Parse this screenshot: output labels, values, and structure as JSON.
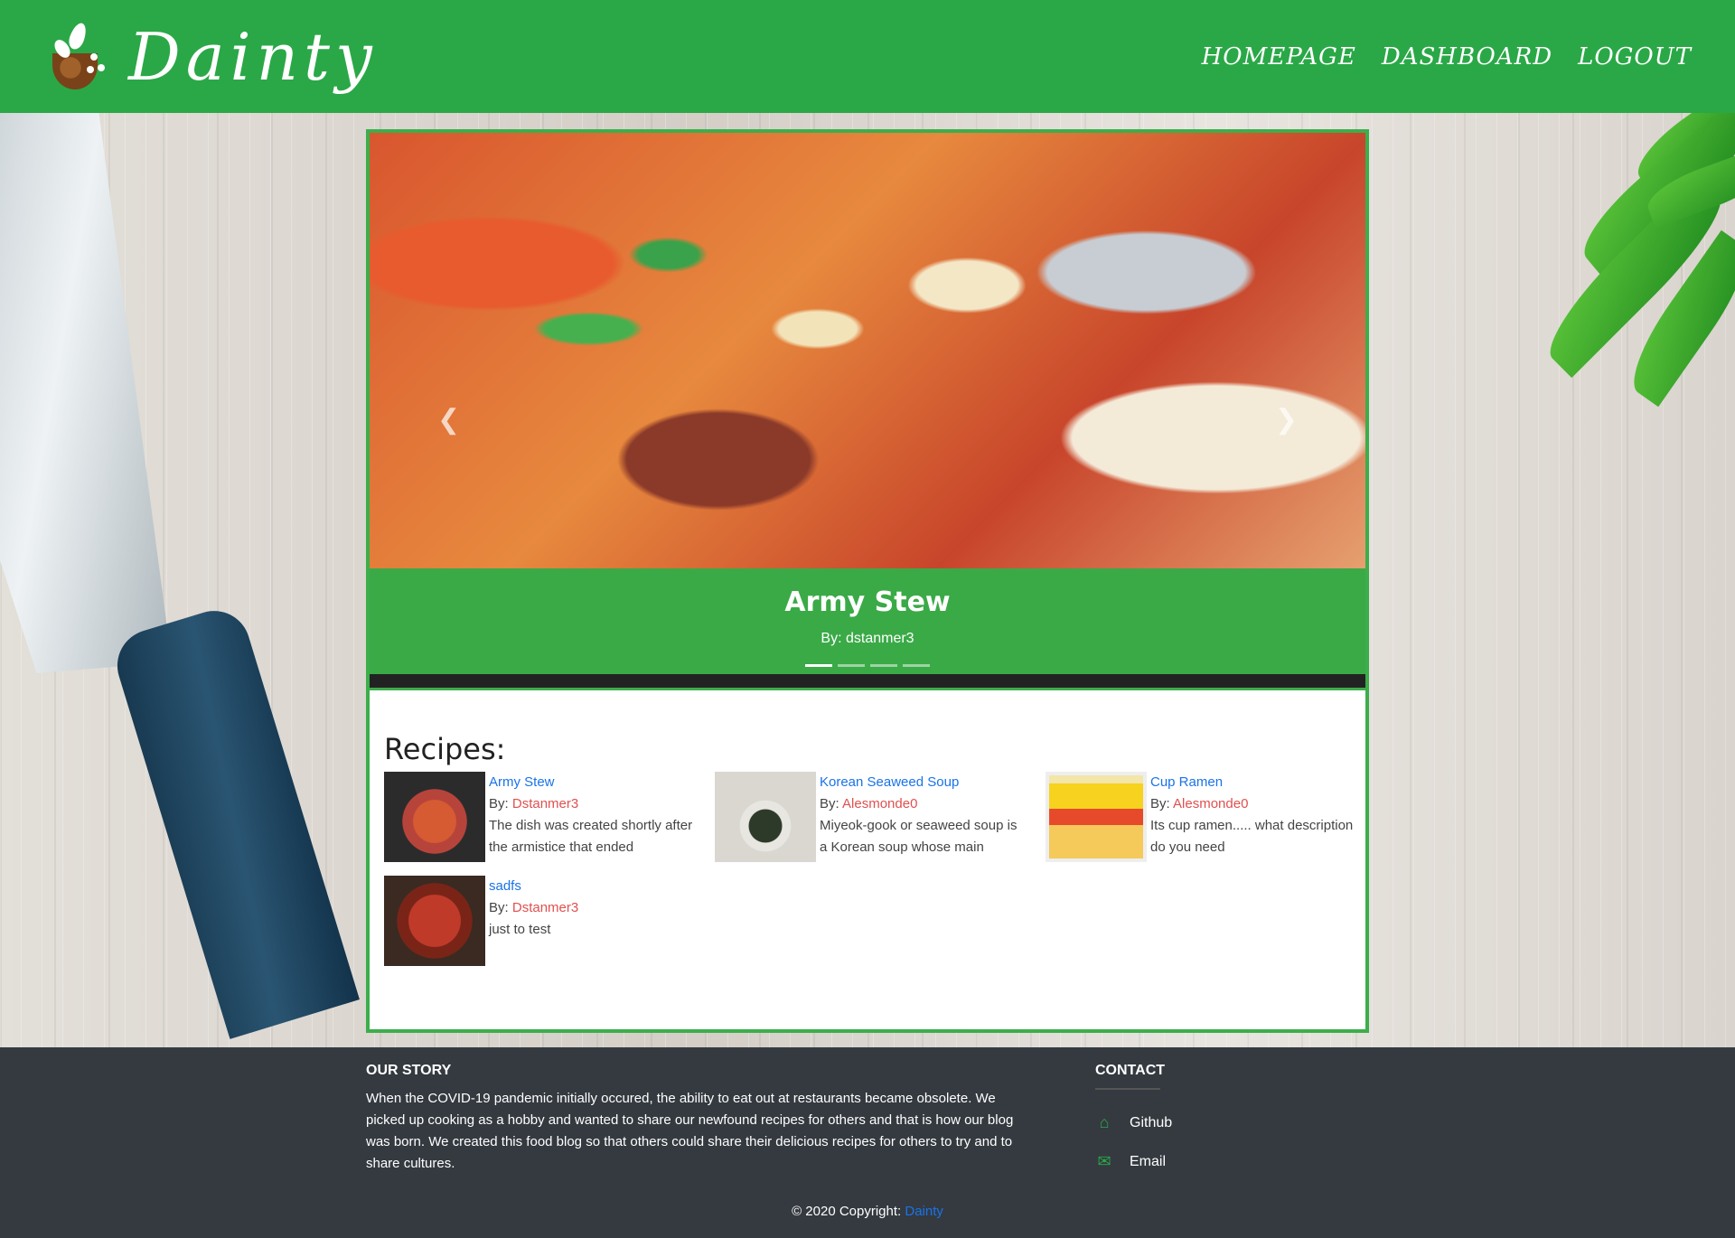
{
  "brand": {
    "name": "Dainty"
  },
  "nav": {
    "items": [
      "HOMEPAGE",
      "DASHBOARD",
      "LOGOUT"
    ]
  },
  "carousel": {
    "title": "Army Stew",
    "byline": "By: dstanmer3",
    "prev_icon": "chevron-left-icon",
    "next_icon": "chevron-right-icon",
    "slides_count": 4,
    "active_index": 0
  },
  "recipes": {
    "heading": "Recipes:",
    "items": [
      {
        "title": "Army Stew",
        "by_label": "By:",
        "author": "Dstanmer3",
        "desc": "The dish was created shortly after the armistice that ended"
      },
      {
        "title": "Korean Seaweed Soup",
        "by_label": "By:",
        "author": "Alesmonde0",
        "desc": "Miyeok-gook or seaweed soup is a Korean soup whose main"
      },
      {
        "title": "Cup Ramen",
        "by_label": "By:",
        "author": "Alesmonde0",
        "desc": "Its cup ramen..... what description do you need"
      },
      {
        "title": "sadfs",
        "by_label": "By:",
        "author": "Dstanmer3",
        "desc": "just to test"
      }
    ]
  },
  "footer": {
    "story_heading": "OUR STORY",
    "story_text": "When the COVID-19 pandemic initially occured, the ability to eat out at restaurants became obsolete. We picked up cooking as a hobby and wanted to share our newfound recipes for others and that is how our blog was born. We created this food blog so that others could share their delicious recipes for others to try and to share cultures.",
    "contact_heading": "CONTACT",
    "contact_items": [
      {
        "icon": "home-icon",
        "label": "Github"
      },
      {
        "icon": "envelope-icon",
        "label": "Email"
      }
    ],
    "copyright_prefix": "© 2020 Copyright:",
    "copyright_link": "Dainty"
  },
  "colors": {
    "brand_green": "#2aa847",
    "footer_bg": "#343a40",
    "link_blue": "#1a73e8",
    "author_red": "#e05050"
  }
}
